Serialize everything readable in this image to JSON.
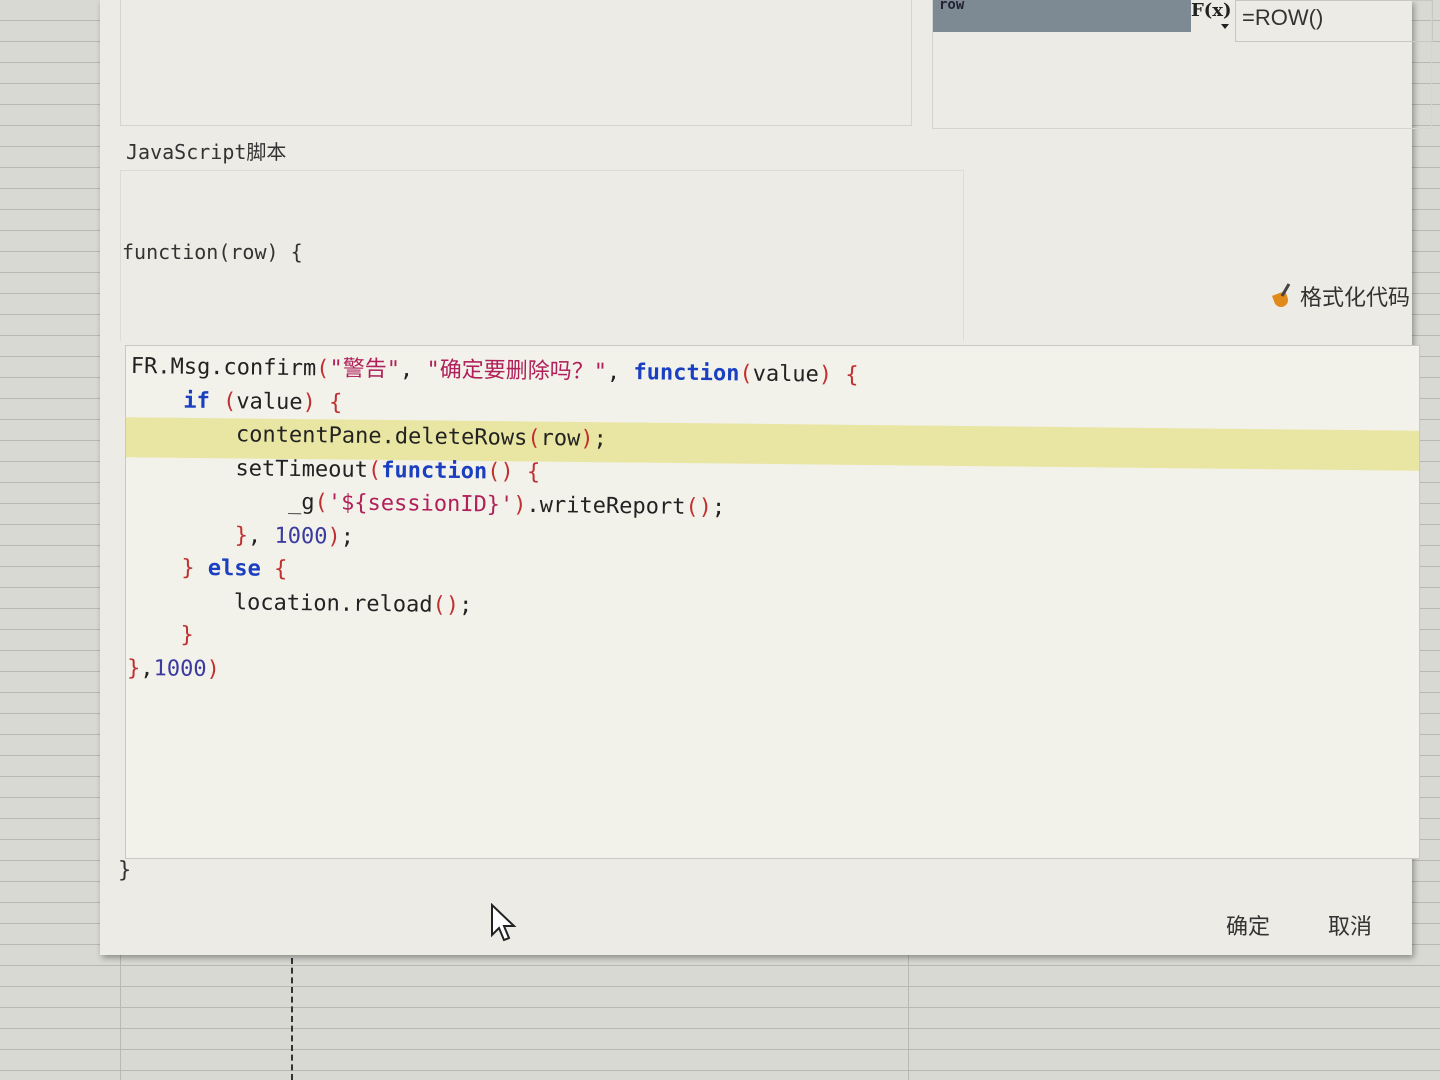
{
  "property_panel": {
    "name": "row",
    "fx_label": "F(x)",
    "formula": "=ROW()"
  },
  "dialog": {
    "section_label": "JavaScript脚本",
    "function_header": "function(row) {",
    "function_footer": "}",
    "format_button": "格式化代码",
    "ok_button": "确定",
    "cancel_button": "取消",
    "highlighted_line": 3
  },
  "code_lines": [
    [
      [
        "plain",
        "FR.Msg.confirm"
      ],
      [
        "paren",
        "("
      ],
      [
        "string",
        "\"警告\""
      ],
      [
        "plain",
        ", "
      ],
      [
        "string",
        "\"确定要删除吗？\""
      ],
      [
        "plain",
        ", "
      ],
      [
        "keyword",
        "function"
      ],
      [
        "paren",
        "("
      ],
      [
        "plain",
        "value"
      ],
      [
        "paren",
        ")"
      ],
      [
        "plain",
        " "
      ],
      [
        "paren",
        "{"
      ]
    ],
    [
      [
        "plain",
        "    "
      ],
      [
        "keyword",
        "if"
      ],
      [
        "plain",
        " "
      ],
      [
        "paren",
        "("
      ],
      [
        "plain",
        "value"
      ],
      [
        "paren",
        ")"
      ],
      [
        "plain",
        " "
      ],
      [
        "paren",
        "{"
      ]
    ],
    [
      [
        "plain",
        "        contentPane.deleteRows"
      ],
      [
        "paren",
        "("
      ],
      [
        "plain",
        "row"
      ],
      [
        "paren",
        ")"
      ],
      [
        "plain",
        ";"
      ]
    ],
    [
      [
        "plain",
        "        setTimeout"
      ],
      [
        "paren",
        "("
      ],
      [
        "keyword",
        "function"
      ],
      [
        "paren",
        "()"
      ],
      [
        "plain",
        " "
      ],
      [
        "paren",
        "{"
      ]
    ],
    [
      [
        "plain",
        "            _g"
      ],
      [
        "paren",
        "("
      ],
      [
        "string",
        "'${sessionID}'"
      ],
      [
        "paren",
        ")"
      ],
      [
        "plain",
        ".writeReport"
      ],
      [
        "paren",
        "()"
      ],
      [
        "plain",
        ";"
      ]
    ],
    [
      [
        "plain",
        "        "
      ],
      [
        "paren",
        "}"
      ],
      [
        "plain",
        ", "
      ],
      [
        "number",
        "1000"
      ],
      [
        "paren",
        ")"
      ],
      [
        "plain",
        ";"
      ]
    ],
    [
      [
        "plain",
        "    "
      ],
      [
        "paren",
        "}"
      ],
      [
        "plain",
        " "
      ],
      [
        "keyword",
        "else"
      ],
      [
        "plain",
        " "
      ],
      [
        "paren",
        "{"
      ]
    ],
    [
      [
        "plain",
        "        location.reload"
      ],
      [
        "paren",
        "()"
      ],
      [
        "plain",
        ";"
      ]
    ],
    [
      [
        "plain",
        "    "
      ],
      [
        "paren",
        "}"
      ]
    ],
    [
      [
        "paren",
        "}"
      ],
      [
        "plain",
        ","
      ],
      [
        "number",
        "1000"
      ],
      [
        "paren",
        ")"
      ]
    ]
  ]
}
